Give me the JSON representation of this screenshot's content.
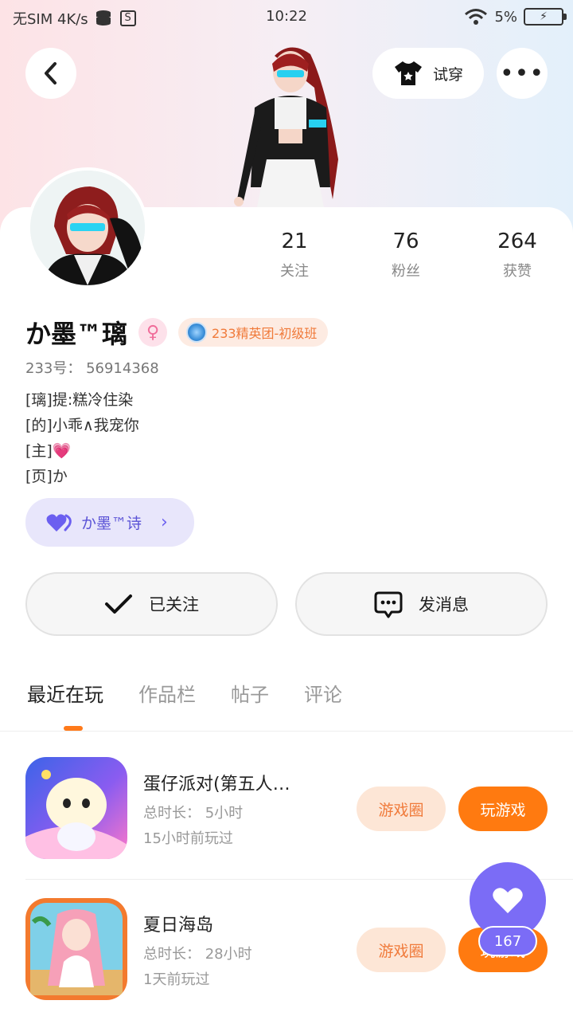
{
  "status_bar": {
    "carrier": "无SIM 4K/s",
    "time": "10:22",
    "battery_percent": "5%",
    "icons": [
      "data-icon",
      "s-app-icon",
      "wifi-icon",
      "battery-icon"
    ]
  },
  "header": {
    "try_on_label": "试穿",
    "more_label": "•••"
  },
  "profile": {
    "name": "か墨™璃",
    "gender_symbol": "♀",
    "guild": "233精英团-初级班",
    "uid": "233号： 56914368",
    "bio": [
      "[璃]提:糕冷住染",
      "[的]小乖∧我宠你",
      "[主]",
      "[页]か"
    ],
    "bio_heart": "💗"
  },
  "stats": [
    {
      "num": "21",
      "label": "关注"
    },
    {
      "num": "76",
      "label": "粉丝"
    },
    {
      "num": "264",
      "label": "获赞"
    }
  ],
  "cp": {
    "name": "か墨™诗",
    "arrow": "›"
  },
  "actions": {
    "follow_label": "已关注",
    "message_label": "发消息"
  },
  "tabs": [
    "最近在玩",
    "作品栏",
    "帖子",
    "评论"
  ],
  "games": [
    {
      "title": "蛋仔派对(第五人…",
      "duration": "总时长： 5小时",
      "last_played": "15小时前玩过",
      "circle_label": "游戏圈",
      "play_label": "玩游戏"
    },
    {
      "title": "夏日海岛",
      "duration": "总时长： 28小时",
      "last_played": "1天前玩过",
      "circle_label": "游戏圈",
      "play_label": "玩游戏"
    }
  ],
  "fab": {
    "count": "167"
  },
  "colors": {
    "accent_orange": "#ff7a10",
    "accent_purple": "#7b6cf6"
  }
}
